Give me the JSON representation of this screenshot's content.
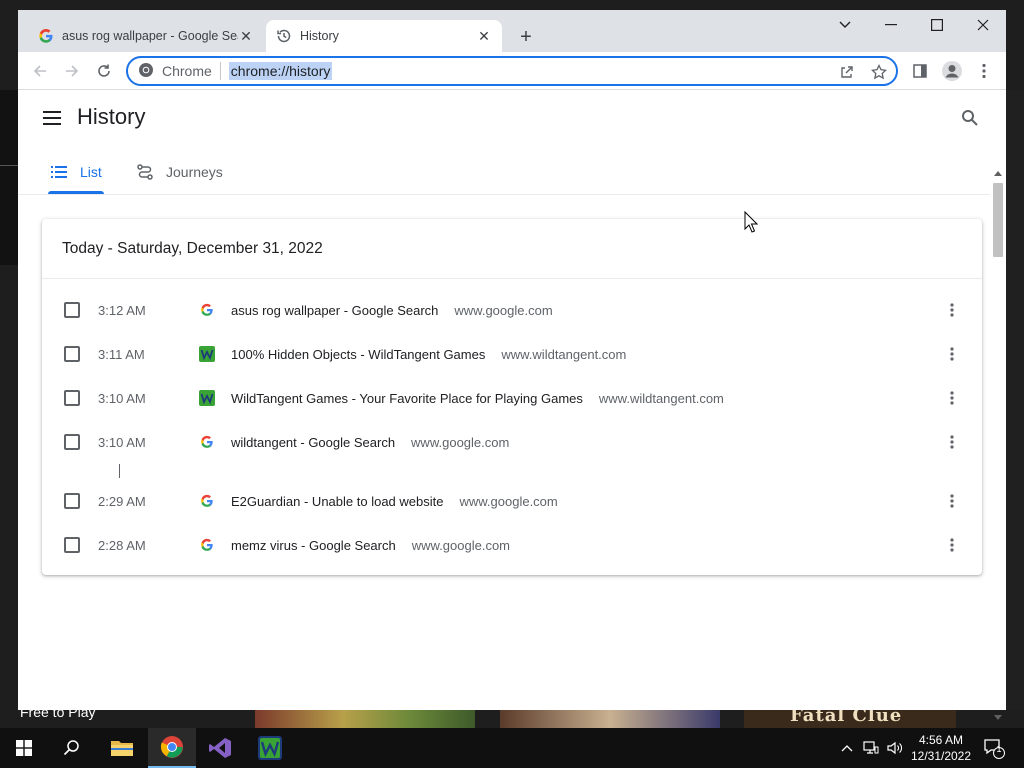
{
  "browser": {
    "tabs": [
      {
        "title": "asus rog wallpaper - Google Search",
        "favicon": "google-icon",
        "active": false
      },
      {
        "title": "History",
        "favicon": "history-icon",
        "active": true
      }
    ],
    "omnibox": {
      "chip": "Chrome",
      "url": "chrome://history"
    }
  },
  "history": {
    "title": "History",
    "tabs": {
      "list": "List",
      "journeys": "Journeys"
    },
    "day_header": "Today - Saturday, December 31, 2022",
    "entries": [
      {
        "time": "3:12 AM",
        "title": "asus rog wallpaper - Google Search",
        "domain": "www.google.com",
        "favicon": "google-icon"
      },
      {
        "time": "3:11 AM",
        "title": "100% Hidden Objects - WildTangent Games",
        "domain": "www.wildtangent.com",
        "favicon": "wildtangent-icon"
      },
      {
        "time": "3:10 AM",
        "title": "WildTangent Games - Your Favorite Place for Playing Games",
        "domain": "www.wildtangent.com",
        "favicon": "wildtangent-icon"
      },
      {
        "time": "3:10 AM",
        "title": "wildtangent - Google Search",
        "domain": "www.google.com",
        "favicon": "google-icon"
      },
      {
        "time": "2:29 AM",
        "title": "E2Guardian - Unable to load website",
        "domain": "www.google.com",
        "favicon": "google-icon"
      },
      {
        "time": "2:28 AM",
        "title": "memz virus - Google Search",
        "domain": "www.google.com",
        "favicon": "google-icon"
      }
    ]
  },
  "background": {
    "free_to_play": "Free to Play",
    "fatal_clue": "Fatal Clue"
  },
  "taskbar": {
    "time": "4:56 AM",
    "date": "12/31/2022",
    "notification_count": "1"
  },
  "colors": {
    "accent": "#1a73e8",
    "omnibox_selection": "#bcd3f5",
    "wildtangent_green": "#3aa335"
  }
}
